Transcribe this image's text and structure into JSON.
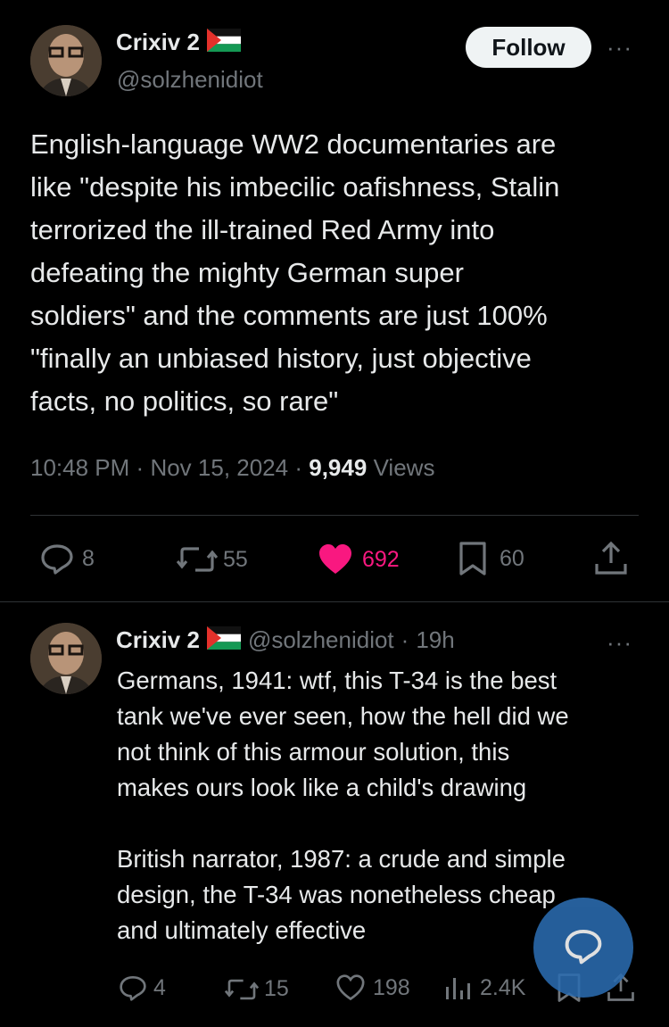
{
  "main_post": {
    "display_name": "Crixiv 2",
    "handle": "@solzhenidiot",
    "follow_label": "Follow",
    "more_label": "···",
    "text": "English-language WW2 documentaries are\nlike \"despite his imbecilic oafishness, Stalin\nterrorized the ill-trained Red Army into\ndefeating the mighty German super\nsoldiers\" and the comments are just 100%\n\"finally an unbiased history, just objective\nfacts, no politics, so rare\"",
    "time": "10:48 PM",
    "date": "Nov 15, 2024",
    "views_count": "9,949",
    "views_label": "Views",
    "stats": {
      "replies": "8",
      "reposts": "55",
      "likes": "692",
      "bookmarks": "60"
    },
    "like_color": "#f91880"
  },
  "reply_post": {
    "display_name": "Crixiv 2",
    "handle": "@solzhenidiot",
    "age": "19h",
    "more_label": "···",
    "text": "Germans, 1941: wtf, this T-34 is the best\ntank we've ever seen, how the hell did we\nnot think of this armour solution, this\nmakes ours look like a child's drawing\n\nBritish narrator, 1987: a crude and simple\ndesign, the T-34 was nonetheless cheap\nand ultimately effective",
    "stats": {
      "replies": "4",
      "reposts": "15",
      "likes": "198",
      "views": "2.4K"
    }
  },
  "colors": {
    "background": "#000000",
    "text": "#e7e9ea",
    "muted": "#71767b",
    "divider": "#2f3336",
    "fab": "#2b6cb0"
  },
  "icons": [
    "flag-icon",
    "reply-icon",
    "repost-icon",
    "like-icon",
    "bookmark-icon",
    "share-icon",
    "views-icon",
    "compose-reply-icon"
  ]
}
